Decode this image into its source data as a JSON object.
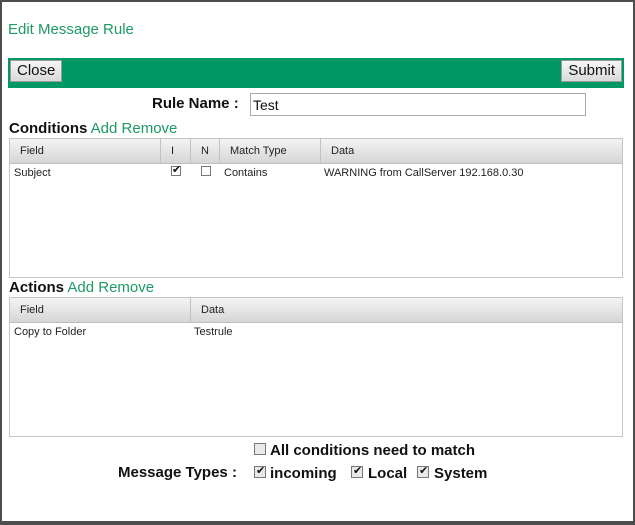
{
  "dialog": {
    "title": "Edit Message Rule"
  },
  "toolbar": {
    "close_label": "Close",
    "submit_label": "Submit"
  },
  "rule": {
    "name_label": "Rule Name :",
    "name_value": "Test"
  },
  "conditions": {
    "label": "Conditions",
    "add_label": "Add",
    "remove_label": "Remove",
    "columns": [
      "Field",
      "I",
      "N",
      "Match Type",
      "Data"
    ],
    "rows": [
      {
        "field": "Subject",
        "i_checked": true,
        "n_checked": false,
        "match_type": "Contains",
        "data": "WARNING from CallServer 192.168.0.30"
      }
    ]
  },
  "actions": {
    "label": "Actions",
    "add_label": "Add",
    "remove_label": "Remove",
    "columns": [
      "Field",
      "Data"
    ],
    "rows": [
      {
        "field": "Copy to Folder",
        "data": "Testrule"
      }
    ]
  },
  "options": {
    "all_conditions_label": "All conditions need to match",
    "all_conditions_checked": false,
    "message_types_label": "Message Types :",
    "types": [
      {
        "label": "incoming",
        "checked": true
      },
      {
        "label": "Local",
        "checked": true
      },
      {
        "label": "System",
        "checked": true
      }
    ]
  },
  "colors": {
    "accent": "#009966",
    "link": "#1e9a66"
  }
}
